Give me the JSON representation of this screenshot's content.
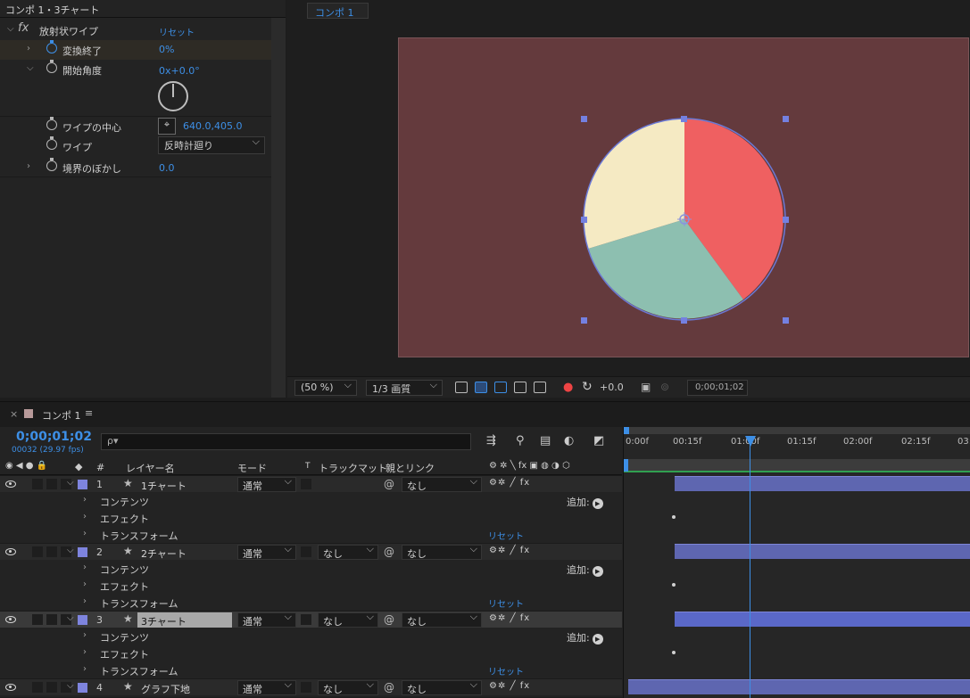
{
  "effect_controls": {
    "header": "コンポ 1・3チャート",
    "effect_name": "放射状ワイプ",
    "reset": "リセット",
    "properties": [
      {
        "name": "変換終了",
        "value": "0%"
      },
      {
        "name": "開始角度",
        "value": "0x+0.0°"
      },
      {
        "name": "ワイプの中心",
        "value": "640.0,405.0"
      },
      {
        "name": "ワイプ",
        "value": "反時計廻り"
      },
      {
        "name": "境界のぼかし",
        "value": "0.0"
      }
    ]
  },
  "viewer": {
    "tab": "コンポ 1",
    "zoom": "(50 %)",
    "quality": "1/3 画質",
    "exposure": "+0.0",
    "timecode": "0;00;01;02",
    "pie_colors": [
      "#ef6061",
      "#8dbfb0",
      "#f5eac3"
    ]
  },
  "timeline": {
    "tab": "コンポ 1",
    "timecode": "0;00;01;02",
    "fps": "00032 (29.97 fps)",
    "search_placeholder": "ρ▾",
    "columns": {
      "layer_name": "レイヤー名",
      "mode": "モード",
      "t": "T",
      "track_matte": "トラックマット",
      "parent": "親とリンク",
      "num": "#"
    },
    "ruler_ticks": [
      "0:00f",
      "00:15f",
      "01:00f",
      "01:15f",
      "02:00f",
      "02:15f",
      "03:0"
    ],
    "layers": [
      {
        "num": "1",
        "name": "1チャート",
        "mode": "通常",
        "track": "",
        "parent": "なし"
      },
      {
        "num": "2",
        "name": "2チャート",
        "mode": "通常",
        "track": "なし",
        "parent": "なし"
      },
      {
        "num": "3",
        "name": "3チャート",
        "mode": "通常",
        "track": "なし",
        "parent": "なし"
      },
      {
        "num": "4",
        "name": "グラフ下地",
        "mode": "通常",
        "track": "なし",
        "parent": "なし"
      }
    ],
    "sub_items": {
      "contents": "コンテンツ",
      "effect": "エフェクト",
      "transform": "トランスフォーム",
      "add": "追加:",
      "reset": "リセット"
    }
  }
}
